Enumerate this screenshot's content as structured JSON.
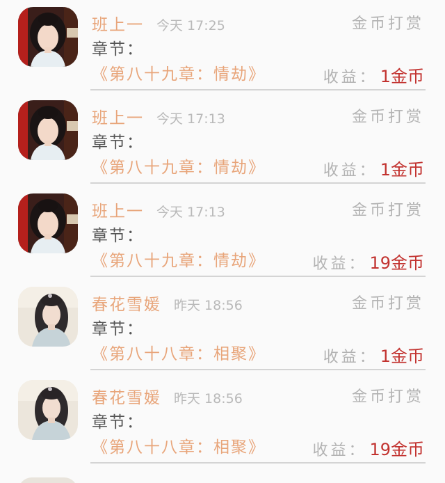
{
  "items": [
    {
      "username": "班上一",
      "time": "今天 17:25",
      "reward_type": "金币打赏",
      "chapter_label": "章节：",
      "chapter_title": "《第八十九章：情劫》",
      "earning_label": "收益：",
      "earning_value": "1金币",
      "avatar_icon": "avatar-girl-red-backdrop-icon"
    },
    {
      "username": "班上一",
      "time": "今天 17:13",
      "reward_type": "金币打赏",
      "chapter_label": "章节：",
      "chapter_title": "《第八十九章：情劫》",
      "earning_label": "收益：",
      "earning_value": "1金币",
      "avatar_icon": "avatar-girl-red-backdrop-icon"
    },
    {
      "username": "班上一",
      "time": "今天 17:13",
      "reward_type": "金币打赏",
      "chapter_label": "章节：",
      "chapter_title": "《第八十九章：情劫》",
      "earning_label": "收益：",
      "earning_value": "19金币",
      "avatar_icon": "avatar-girl-red-backdrop-icon"
    },
    {
      "username": "春花雪媛",
      "time": "昨天 18:56",
      "reward_type": "金币打赏",
      "chapter_label": "章节：",
      "chapter_title": "《第八十八章：相聚》",
      "earning_label": "收益：",
      "earning_value": "1金币",
      "avatar_icon": "avatar-girl-light-backdrop-icon"
    },
    {
      "username": "春花雪媛",
      "time": "昨天 18:56",
      "reward_type": "金币打赏",
      "chapter_label": "章节：",
      "chapter_title": "《第八十八章：相聚》",
      "earning_label": "收益：",
      "earning_value": "19金币",
      "avatar_icon": "avatar-girl-light-backdrop-icon"
    }
  ],
  "colors": {
    "username": "#e8a57a",
    "chapter_title": "#e8a57a",
    "earning_value": "#c2322f",
    "muted": "#b3b3b3",
    "divider": "#d4d4d4"
  }
}
